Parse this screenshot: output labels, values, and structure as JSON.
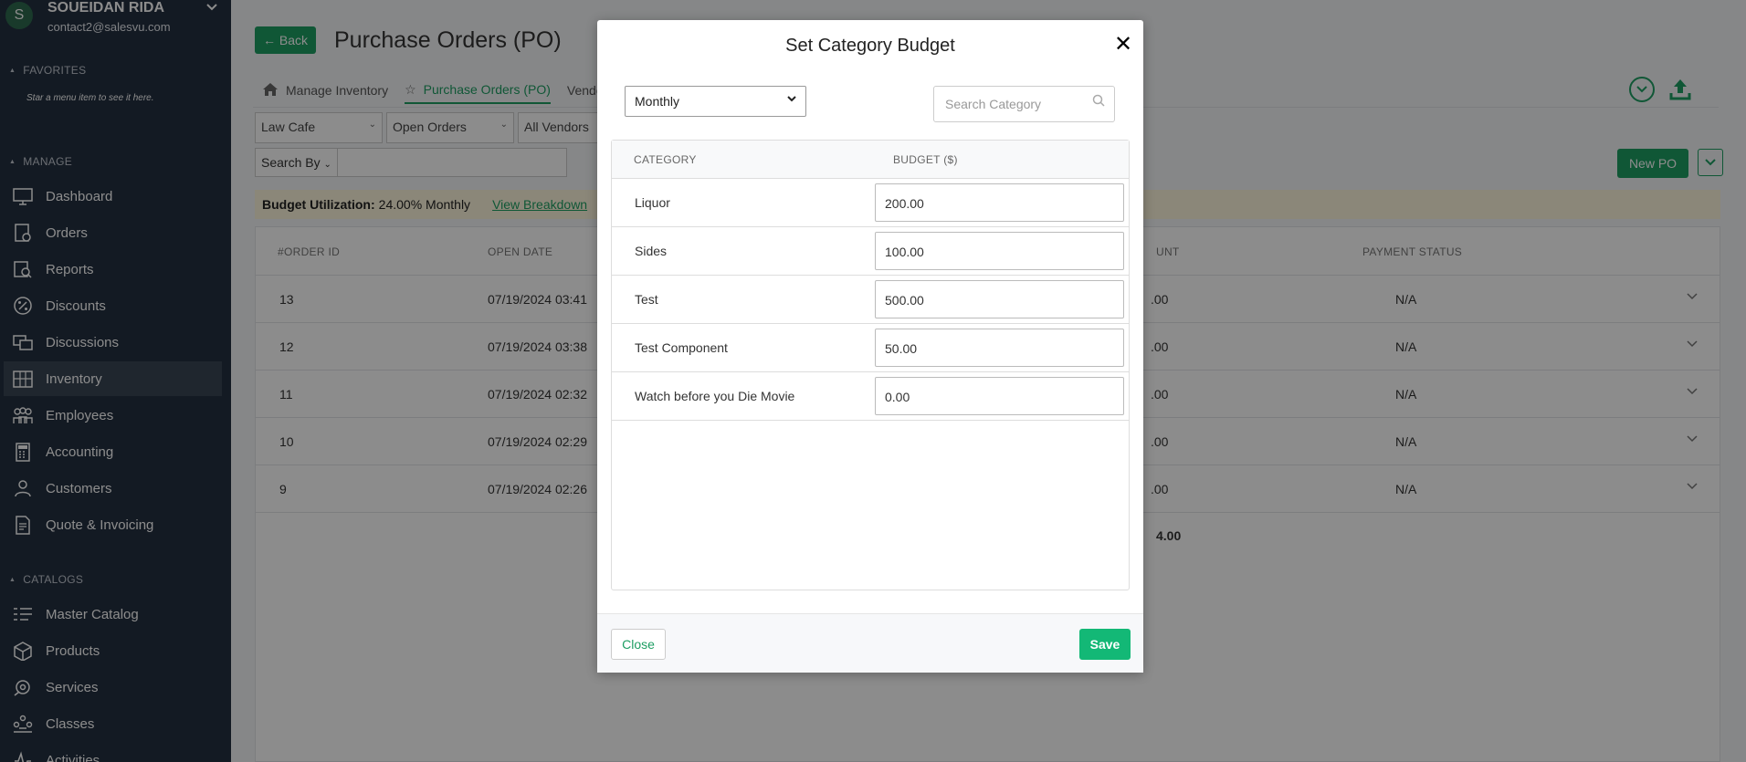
{
  "user": {
    "initial": "S",
    "name": "SOUEIDAN RIDA",
    "email": "contact2@salesvu.com"
  },
  "sidebar": {
    "favorites_title": "FAVORITES",
    "favorites_hint": "Star a menu item to see it here.",
    "manage_title": "MANAGE",
    "manage_items": [
      {
        "label": "Dashboard",
        "icon": "monitor-icon"
      },
      {
        "label": "Orders",
        "icon": "orders-icon"
      },
      {
        "label": "Reports",
        "icon": "reports-icon"
      },
      {
        "label": "Discounts",
        "icon": "discount-icon"
      },
      {
        "label": "Discussions",
        "icon": "discussions-icon"
      },
      {
        "label": "Inventory",
        "icon": "inventory-icon",
        "active": true
      },
      {
        "label": "Employees",
        "icon": "employees-icon"
      },
      {
        "label": "Accounting",
        "icon": "calculator-icon"
      },
      {
        "label": "Customers",
        "icon": "customers-icon"
      },
      {
        "label": "Quote & Invoicing",
        "icon": "invoice-icon"
      }
    ],
    "catalogs_title": "CATALOGS",
    "catalog_items": [
      {
        "label": "Master Catalog",
        "icon": "list-icon"
      },
      {
        "label": "Products",
        "icon": "box-icon"
      },
      {
        "label": "Services",
        "icon": "services-icon"
      },
      {
        "label": "Classes",
        "icon": "classes-icon"
      },
      {
        "label": "Activities",
        "icon": "activities-icon"
      }
    ]
  },
  "main": {
    "back_label": "← Back",
    "title": "Purchase Orders (PO)",
    "tabs": [
      {
        "label": "Manage Inventory"
      },
      {
        "label": "Purchase Orders (PO)",
        "active": true
      },
      {
        "label": "Vendo"
      }
    ],
    "filters": [
      "Law Cafe",
      "Open Orders",
      "All Vendors"
    ],
    "search_by_label": "Search By",
    "budget_label": "Budget Utilization:",
    "budget_value": "24.00% Monthly",
    "budget_link": "View Breakdown",
    "new_po_label": "New PO",
    "columns": {
      "order_id": "#ORDER ID",
      "open_date": "OPEN DATE",
      "amount": "UNT",
      "payment_status": "PAYMENT STATUS"
    },
    "rows": [
      {
        "id": "13",
        "date": "07/19/2024 03:41",
        "amount": ".00",
        "status": "N/A"
      },
      {
        "id": "12",
        "date": "07/19/2024 03:38",
        "amount": ".00",
        "status": "N/A"
      },
      {
        "id": "11",
        "date": "07/19/2024 02:32",
        "amount": ".00",
        "status": "N/A"
      },
      {
        "id": "10",
        "date": "07/19/2024 02:29",
        "amount": ".00",
        "status": "N/A"
      },
      {
        "id": "9",
        "date": "07/19/2024 02:26",
        "amount": ".00",
        "status": "N/A"
      }
    ],
    "total": "4.00"
  },
  "modal": {
    "title": "Set Category Budget",
    "period": "Monthly",
    "search_placeholder": "Search Category",
    "col_category": "CATEGORY",
    "col_budget": "BUDGET ($)",
    "rows": [
      {
        "name": "Liquor",
        "budget": "200.00"
      },
      {
        "name": "Sides",
        "budget": "100.00"
      },
      {
        "name": "Test",
        "budget": "500.00"
      },
      {
        "name": "Test Component",
        "budget": "50.00"
      },
      {
        "name": "Watch before you Die Movie",
        "budget": "0.00"
      }
    ],
    "close_label": "Close",
    "save_label": "Save"
  },
  "colors": {
    "brand_green": "#1e9e63",
    "save_green": "#13b876",
    "sidebar_bg": "#243040"
  }
}
